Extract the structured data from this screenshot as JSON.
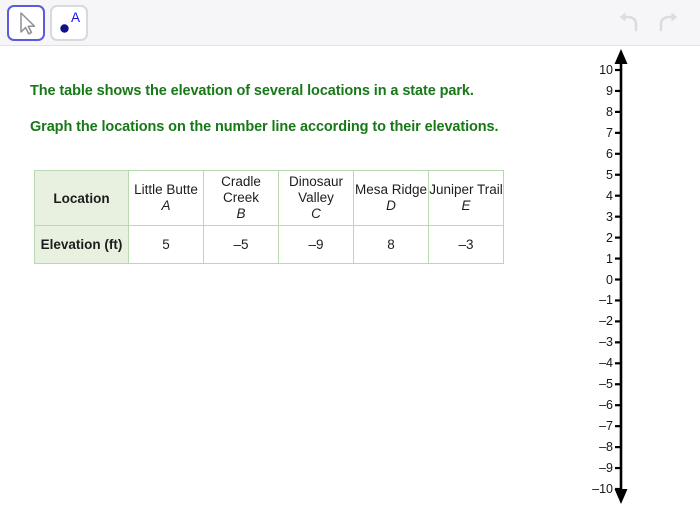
{
  "toolbar": {
    "tools": [
      {
        "name": "select-tool",
        "icon": "cursor-arrow-icon",
        "label": "Select",
        "active": true
      },
      {
        "name": "point-tool",
        "icon": "point-with-label-icon",
        "label": "Point",
        "point_label": "A",
        "active": false
      }
    ],
    "history": [
      {
        "name": "undo-button",
        "icon": "undo-arrow-icon",
        "label": "Undo",
        "enabled": false
      },
      {
        "name": "redo-button",
        "icon": "redo-arrow-icon",
        "label": "Redo",
        "enabled": false
      }
    ],
    "colors": {
      "active_border": "#5b5bdd",
      "inactive_border": "#d8d8dd",
      "background": "#f6f6f8",
      "history_icon": "#dcdcdc"
    }
  },
  "prompt": {
    "color": "#187818",
    "lines": [
      "The table shows the elevation of several locations in a state park.",
      "Graph the locations on the number line according to their elevations."
    ]
  },
  "table": {
    "border_color": "#b9d9b2",
    "header_fill": "#e8f1e0",
    "row_labels": [
      "Location",
      "Elevation (ft)"
    ],
    "columns": [
      {
        "name": "Little Butte",
        "letter": "A",
        "elevation": "5"
      },
      {
        "name": "Cradle Creek",
        "letter": "B",
        "elevation": "–5"
      },
      {
        "name": "Dinosaur Valley",
        "letter": "C",
        "elevation": "–9"
      },
      {
        "name": "Mesa Ridge",
        "letter": "D",
        "elevation": "8"
      },
      {
        "name": "Juniper Trail",
        "letter": "E",
        "elevation": "–3"
      }
    ]
  },
  "number_line": {
    "orientation": "vertical",
    "axis_color": "#000000",
    "min": -10,
    "max": 10,
    "step": 1,
    "arrow_top": true,
    "arrow_bottom": true,
    "tick_labels": [
      "10",
      "9",
      "8",
      "7",
      "6",
      "5",
      "4",
      "3",
      "2",
      "1",
      "0",
      "–1",
      "–2",
      "–3",
      "–4",
      "–5",
      "–6",
      "–7",
      "–8",
      "–9",
      "–10"
    ],
    "plotted_points": []
  }
}
